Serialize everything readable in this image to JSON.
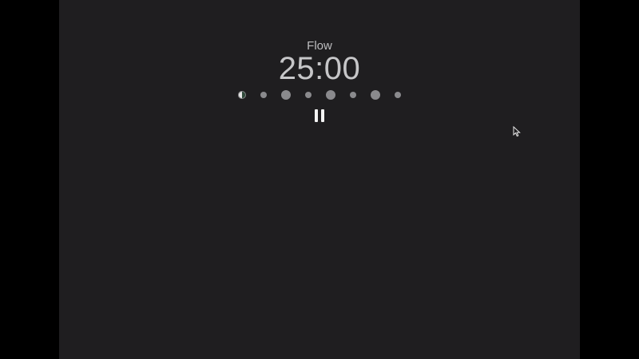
{
  "timer": {
    "mode_label": "Flow",
    "time": "25:00",
    "state": "running",
    "control_icon": "pause-icon"
  },
  "sessions": {
    "dots": [
      {
        "kind": "current"
      },
      {
        "kind": "small"
      },
      {
        "kind": "large"
      },
      {
        "kind": "small"
      },
      {
        "kind": "large"
      },
      {
        "kind": "small"
      },
      {
        "kind": "large"
      },
      {
        "kind": "small"
      }
    ]
  },
  "colors": {
    "window_background": "#1f1e20",
    "outer_background": "#000000",
    "text": "#c6c6c8",
    "dot": "#8a8a8d",
    "progress_green": "#2f4a3a"
  }
}
